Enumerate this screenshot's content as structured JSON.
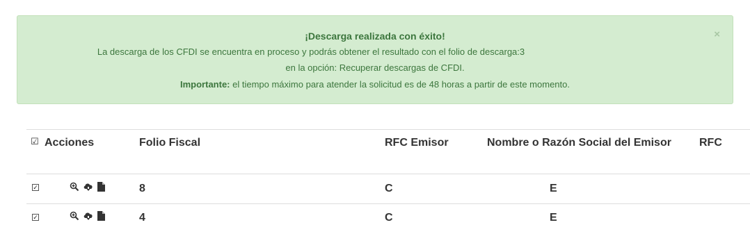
{
  "alert": {
    "title": "¡Descarga realizada con éxito!",
    "message_line1": "La descarga de los CFDI se encuentra en proceso y podrás obtener el resultado con el folio de descarga:3",
    "message_line2": "en la opción: Recuperar descargas de CFDI.",
    "important_label": "Importante:",
    "important_text": " el tiempo máximo para atender la solicitud es de 48 horas a partir de este momento.",
    "close_symbol": "×",
    "colors": {
      "background": "#d4ecd0",
      "text": "#3c763d"
    }
  },
  "table": {
    "headers": {
      "select_all_mark": "☑",
      "acciones": "Acciones",
      "folio_fiscal": "Folio Fiscal",
      "rfc_emisor": "RFC Emisor",
      "nombre_emisor": "Nombre o Razón Social del Emisor",
      "rfc_receptor": "RFC"
    },
    "rows": [
      {
        "check_mark": "✓",
        "icons": [
          "zoom-in-icon",
          "cloud-download-icon",
          "file-icon"
        ],
        "folio": "8",
        "rfc_emisor": "C",
        "nombre_emisor": "E"
      },
      {
        "check_mark": "✓",
        "icons": [
          "zoom-in-icon",
          "cloud-download-icon",
          "file-icon"
        ],
        "folio": "4",
        "rfc_emisor": "C",
        "nombre_emisor": "E"
      }
    ]
  }
}
